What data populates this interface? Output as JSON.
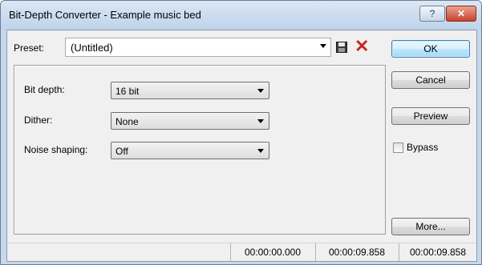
{
  "window": {
    "title": "Bit-Depth Converter - Example music bed"
  },
  "titlebar": {
    "help_label": "?",
    "close_label": "✕"
  },
  "preset": {
    "label": "Preset:",
    "value": "(Untitled)"
  },
  "settings": {
    "bit_depth": {
      "label": "Bit depth:",
      "value": "16 bit"
    },
    "dither": {
      "label": "Dither:",
      "value": "None"
    },
    "noise_shaping": {
      "label": "Noise shaping:",
      "value": "Off"
    }
  },
  "buttons": {
    "ok": "OK",
    "cancel": "Cancel",
    "preview": "Preview",
    "more": "More..."
  },
  "bypass": {
    "label": "Bypass",
    "checked": false
  },
  "status": {
    "start": "00:00:00.000",
    "end": "00:00:09.858",
    "length": "00:00:09.858"
  }
}
